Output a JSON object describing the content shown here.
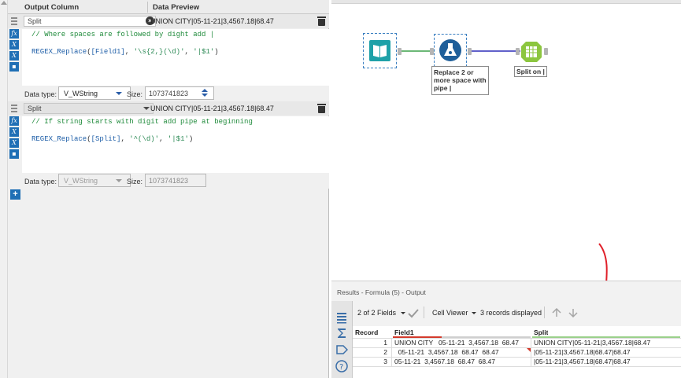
{
  "formula": {
    "header": {
      "output_column": "Output Column",
      "data_preview": "Data Preview"
    },
    "expressions": [
      {
        "column": "Split",
        "preview": "UNION CITY|05-11-21|3,4567.18|68.47",
        "comment": "// Where spaces are followed by dight add |",
        "code": {
          "fn": "REGEX_Replace",
          "open": "(",
          "field": "[Field1]",
          "args": ", ",
          "pattern": "'\\s{2,}(\\d)'",
          "sep": ", ",
          "replacement": "'|$1'",
          "close": ")"
        },
        "data_type_label": "Data type:",
        "data_type": "V_WString",
        "size_label": "Size:",
        "size": "1073741823"
      },
      {
        "column": "Split",
        "preview": "UNION CITY|05-11-21|3,4567.18|68.47",
        "comment": "// If string starts with digit add pipe at beginning",
        "code": {
          "fn": "REGEX_Replace",
          "open": "(",
          "field": "[Split]",
          "args": ", ",
          "pattern": "'^(\\d)'",
          "sep": ", ",
          "replacement": "'|$1'",
          "close": ")"
        },
        "data_type_label": "Data type:",
        "data_type": "V_WString",
        "size_label": "Size:",
        "size": "1073741823"
      }
    ],
    "side_icons": [
      "fx",
      "X",
      "X",
      "save"
    ],
    "add_label": "+"
  },
  "canvas": {
    "tools": [
      {
        "name": "input-tool",
        "icon": "book-icon",
        "color": "#1ea1a8"
      },
      {
        "name": "formula-tool",
        "icon": "flask-icon",
        "color": "#1f5f9a",
        "label": "Replace 2 or more space with pipe |"
      },
      {
        "name": "text-to-columns-tool",
        "icon": "columns-icon",
        "color": "#8cc63f",
        "label": "Split on |"
      }
    ],
    "connection_colors": {
      "input_to_formula": "#3ca04a",
      "formula_to_split": "#2d2db8"
    }
  },
  "results": {
    "title": "Results - Formula (5) - Output",
    "fields_dropdown": "2 of 2 Fields",
    "cell_viewer": "Cell Viewer",
    "records_displayed": "3 records displayed",
    "columns": [
      "Record",
      "Field1",
      "Split"
    ],
    "rows": [
      {
        "record": "1",
        "field1": "UNION CITY   05-11-21  3,4567.18  68.47",
        "split": "UNION CITY|05-11-21|3,4567.18|68.47"
      },
      {
        "record": "2",
        "field1": "  05-11-21  3,4567.18  68.47  68.47",
        "split": "|05-11-21|3,4567.18|68.47|68.47"
      },
      {
        "record": "3",
        "field1": "05-11-21  3,4567.18  68.47  68.47",
        "split": "|05-11-21|3,4567.18|68.47|68.47"
      }
    ],
    "annotation_arrow_color": "#e0202a",
    "field_underline_colors": {
      "field1": "#d33a2c",
      "split": "#9ad08a"
    }
  }
}
